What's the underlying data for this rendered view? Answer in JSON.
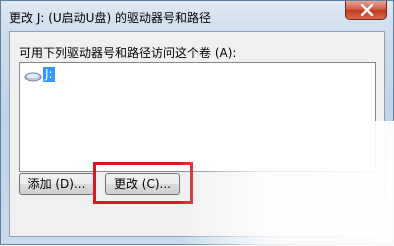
{
  "window": {
    "title": "更改 J: (U启动U盘) 的驱动器号和路径"
  },
  "dialog": {
    "volume_label": "可用下列驱动器号和路径访问这个卷 (A):",
    "list": {
      "items": [
        {
          "label": "J:",
          "icon": "drive-icon",
          "selected": true
        }
      ]
    },
    "buttons": {
      "add_label": "添加 (D)...",
      "change_label": "更改 (C)..."
    }
  },
  "colors": {
    "selection": "#3399ff",
    "highlight": "#e0141e",
    "close_button": "#c3361d"
  }
}
